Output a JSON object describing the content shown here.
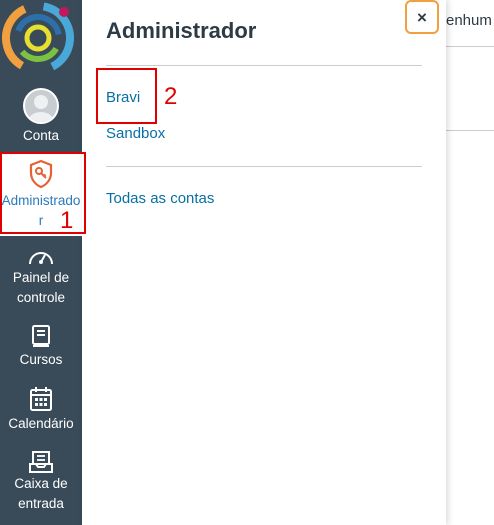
{
  "global_nav": {
    "account_label": "Conta",
    "admin_label_line1": "Administrado",
    "admin_label_line2": "r",
    "dashboard_label_line1": "Painel de",
    "dashboard_label_line2": "controle",
    "courses_label": "Cursos",
    "calendar_label": "Calendário",
    "inbox_label_line1": "Caixa de",
    "inbox_label_line2": "entrada"
  },
  "tray": {
    "title": "Administrador",
    "close_label": "×",
    "accounts": [
      "Bravi",
      "Sandbox"
    ],
    "all_accounts_label": "Todas as contas"
  },
  "annotations": {
    "callout_1": "1",
    "callout_2": "2"
  },
  "background": {
    "peek_text": "enhum"
  },
  "colors": {
    "nav_bg": "#394b58",
    "link": "#0770a3",
    "active": "#2b7abc",
    "admin_icon": "#e66135",
    "annotation_red": "#e00000",
    "close_focus": "#f0a040"
  }
}
